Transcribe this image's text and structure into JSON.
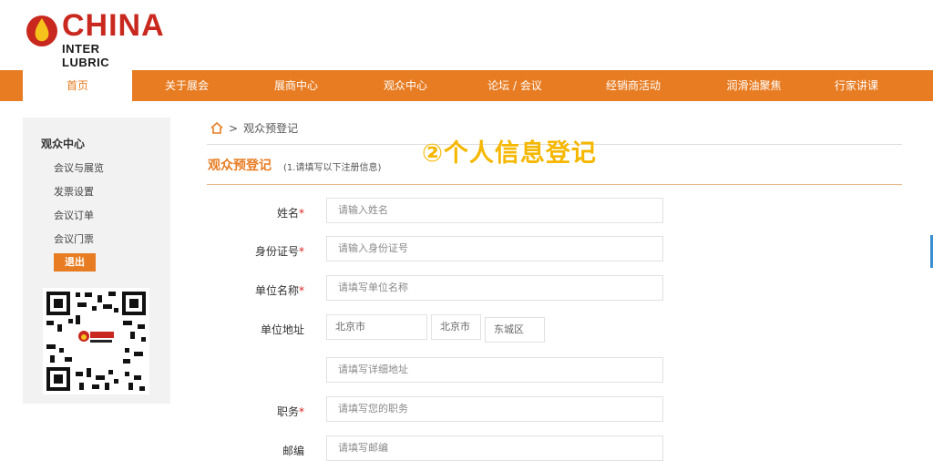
{
  "logo": {
    "main": "CHINA",
    "sub": "INTER LUBRIC"
  },
  "nav": {
    "items": [
      {
        "label": "首页",
        "active": true
      },
      {
        "label": "关于展会",
        "active": false
      },
      {
        "label": "展商中心",
        "active": false
      },
      {
        "label": "观众中心",
        "active": false
      },
      {
        "label": "论坛 / 会议",
        "active": false
      },
      {
        "label": "经销商活动",
        "active": false
      },
      {
        "label": "润滑油聚焦",
        "active": false
      },
      {
        "label": "行家讲课",
        "active": false
      }
    ]
  },
  "sidebar": {
    "title": "观众中心",
    "items": [
      "会议与展览",
      "发票设置",
      "会议订单",
      "会议门票"
    ],
    "logout": "退出"
  },
  "breadcrumb": {
    "separator": ">",
    "current": "观众预登记"
  },
  "overlay": {
    "title": "②个人信息登记"
  },
  "section": {
    "title": "观众预登记",
    "note": "(1.请填写以下注册信息)"
  },
  "form": {
    "name": {
      "label": "姓名",
      "required": "*",
      "placeholder": "请输入姓名"
    },
    "id_number": {
      "label": "身份证号",
      "required": "*",
      "placeholder": "请输入身份证号"
    },
    "company": {
      "label": "单位名称",
      "required": "*",
      "placeholder": "请填写单位名称"
    },
    "address": {
      "label": "单位地址",
      "province": "北京市",
      "city": "北京市",
      "district": "东城区",
      "detail_placeholder": "请填写详细地址"
    },
    "position": {
      "label": "职务",
      "required": "*",
      "placeholder": "请填写您的职务"
    },
    "postcode": {
      "label": "邮编",
      "placeholder": "请填写邮编"
    }
  },
  "colors": {
    "accent": "#e87c22",
    "overlay": "#f5b700",
    "required": "#d9231f"
  }
}
